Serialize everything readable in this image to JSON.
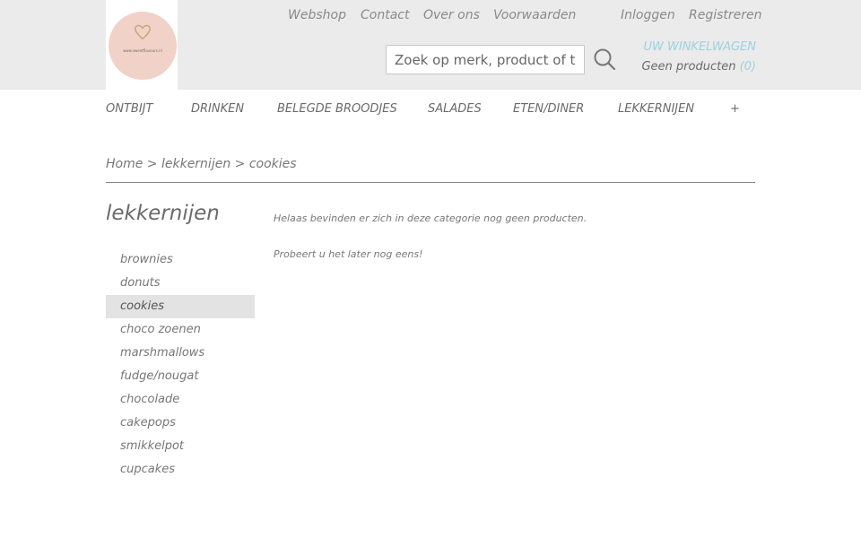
{
  "logo": {
    "text": "www.sweetflavours.nl",
    "heart_color": "#c9a96e"
  },
  "toplinks": {
    "webshop": "Webshop",
    "contact": "Contact",
    "over_ons": "Over ons",
    "voorwaarden": "Voorwaarden",
    "inloggen": "Inloggen",
    "registreren": "Registreren"
  },
  "search": {
    "placeholder": "Zoek op merk, product of trefwoord",
    "icon": "search-icon"
  },
  "cart": {
    "title": "UW WINKELWAGEN",
    "status": "Geen producten",
    "count": "(0)"
  },
  "nav": {
    "items": [
      "ONTBIJT",
      "DRINKEN",
      "BELEGDE BROODJES",
      "SALADES",
      "ETEN/DINER",
      "LEKKERNIJEN",
      "+"
    ]
  },
  "breadcrumb": "Home > lekkernijen > cookies",
  "category": {
    "title": "lekkernijen",
    "subcategories": [
      "brownies",
      "donuts",
      "cookies",
      "choco zoenen",
      "marshmallows",
      "fudge/nougat",
      "chocolade",
      "cakepops",
      "smikkelpot",
      "cupcakes"
    ],
    "active": "cookies"
  },
  "messages": {
    "line1": "Helaas bevinden er zich in deze categorie nog geen producten.",
    "line2": "Probeert u het later nog eens!"
  },
  "colors": {
    "accent": "#9ed0df",
    "topbar": "#ebebeb",
    "logo_bg": "#f0d2c8"
  }
}
